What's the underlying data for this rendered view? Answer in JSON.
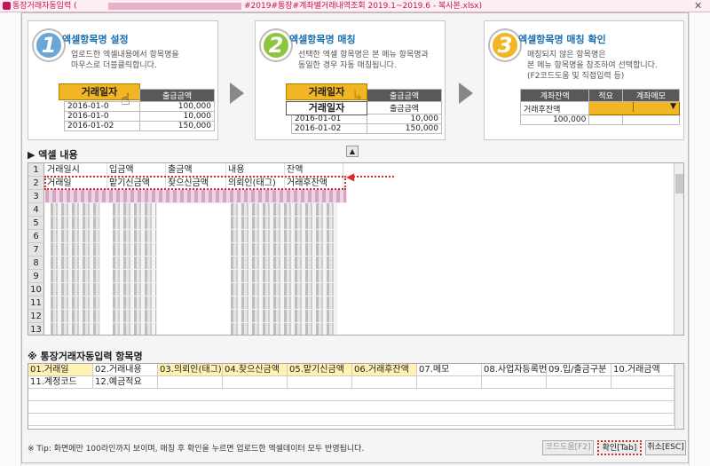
{
  "window": {
    "title_prefix": "통장거래자동입력 (",
    "title_file": "#2019#통장#계좌별거래내역조회 2019.1~2019.6 - 복사본.xlsx)",
    "close": "✕"
  },
  "steps": [
    {
      "num": "1",
      "title": "엑셀항목명 설정",
      "desc": "업로드한 엑셀내용에서 항목명을\n마우스로 더블클릭합니다.",
      "button": "거래일자",
      "col_header": "출금금액",
      "rows": [
        [
          "2016-01-0",
          "100,000"
        ],
        [
          "2016-01-0",
          "10,000"
        ],
        [
          "2016-01-02",
          "150,000"
        ]
      ]
    },
    {
      "num": "2",
      "title": "엑셀항목명 매칭",
      "desc": "선택한 엑셀 항목명은 본 메뉴 항목명과\n동일한 경우 자동 매칭됩니다.",
      "button": "거래일자",
      "dropdown_item": "거래일자",
      "col_header": "출금금액",
      "col_sub": "출금금액",
      "rows": [
        [
          "2016-01-01",
          "10,000"
        ],
        [
          "2016-01-02",
          "150,000"
        ]
      ]
    },
    {
      "num": "3",
      "title": "엑셀항목명 매칭 확인",
      "desc": "매칭되지 않은 항목명은\n본 메뉴 항목명을 참조하여 선택합니다.\n(F2코드도움 및 직접입력 등)",
      "headers": [
        "계좌잔액",
        "적요",
        "계좌메모"
      ],
      "row_label": "거래후잔액",
      "row_value": "100,000"
    }
  ],
  "excel_section": {
    "title": "▶ 엑셀 내용",
    "collapse": "▲",
    "header_row": [
      "거래일시",
      "입금액",
      "출금액",
      "내용",
      "잔액"
    ],
    "label_row": [
      "거래일",
      "맡기신금액",
      "찾으신금액",
      "의뢰인(태그)",
      "거래후잔액"
    ],
    "row_numbers": [
      "1",
      "2",
      "3",
      "4",
      "5",
      "6",
      "7",
      "8",
      "9",
      "10",
      "11",
      "12",
      "13"
    ]
  },
  "mapping_section": {
    "title": "※ 통장거래자동입력 항목명",
    "row1": [
      "01.거래일",
      "02.거래내용",
      "03.의뢰인(태그)",
      "04.찾으신금액",
      "05.맡기신금액",
      "06.거래후잔액",
      "07.메모",
      "08.사업자등록번호",
      "09.입/출금구분",
      "10.거래금액"
    ],
    "row2": [
      "11.계정코드",
      "12.예금적요",
      "",
      "",
      "",
      "",
      "",
      "",
      "",
      ""
    ]
  },
  "footer": {
    "tip": "※ Tip: 화면에만 100라인까지 보이며, 매칭 후 확인을 누르면 업로드한 엑셀데이터 모두 반영됩니다.",
    "code_help_label": "코드도움[F2]",
    "confirm_label": "확인[Tab]",
    "cancel_label": "취소[ESC]"
  },
  "colors": {
    "accent": "#f2b524",
    "step_blue": "#1a6fb0",
    "highlight": "#fff2b3",
    "dotted_red": "#d32f2f"
  }
}
